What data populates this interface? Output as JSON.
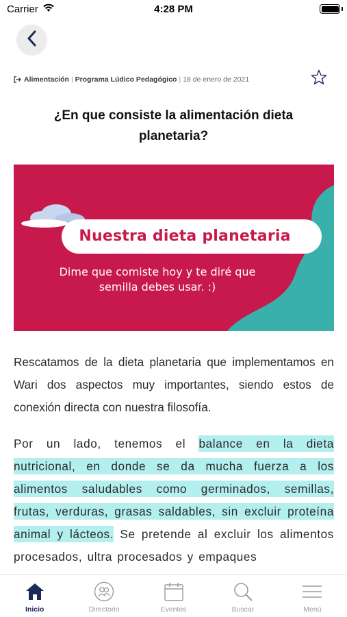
{
  "status_bar": {
    "carrier": "Carrier",
    "time": "4:28 PM",
    "icons": [
      "wifi-icon",
      "battery-icon"
    ]
  },
  "nav": {
    "back_icon": "chevron-left-icon",
    "favorite_icon": "star-outline-icon"
  },
  "meta": {
    "share_icon": "share-arrow-icon",
    "category": "Alimentación",
    "separator": "|",
    "program": "Programa Lúdico Pedagógico",
    "date": "18 de enero de 2021"
  },
  "article": {
    "title": "¿En que consiste la alimentación dieta planetaria?",
    "hero": {
      "title": "Nuestra dieta planetaria",
      "subtitle": "Dime que comiste hoy y te diré que semilla debes usar. :)",
      "colors": {
        "background": "#c8194c",
        "accent": "#3ab0ad",
        "cloud": "#c9d6ef"
      }
    },
    "paragraph_1": "Rescatamos de la dieta planetaria que implementamos en Wari dos aspectos muy importantes, siendo estos de conexión directa con nuestra filosofía.",
    "paragraph_2_lead": "Por un lado, tenemos el ",
    "paragraph_2_highlight": "balance en la dieta nutricional, en donde se da mucha fuerza a los alimentos saludables como germinados, semillas, frutas, verduras, grasas saldables, sin excluir proteína animal y lácteos.",
    "paragraph_2_tail": " Se pretende al excluir los alimentos procesados, ultra procesados y empaques",
    "highlight_color": "#b3efee"
  },
  "tab_bar": {
    "active": "Inicio",
    "active_color": "#1b2a57",
    "items": [
      {
        "label": "Inicio",
        "icon": "home-icon"
      },
      {
        "label": "Directorio",
        "icon": "people-icon"
      },
      {
        "label": "Eventos",
        "icon": "calendar-icon"
      },
      {
        "label": "Buscar",
        "icon": "search-icon"
      },
      {
        "label": "Menú",
        "icon": "menu-icon"
      }
    ]
  }
}
